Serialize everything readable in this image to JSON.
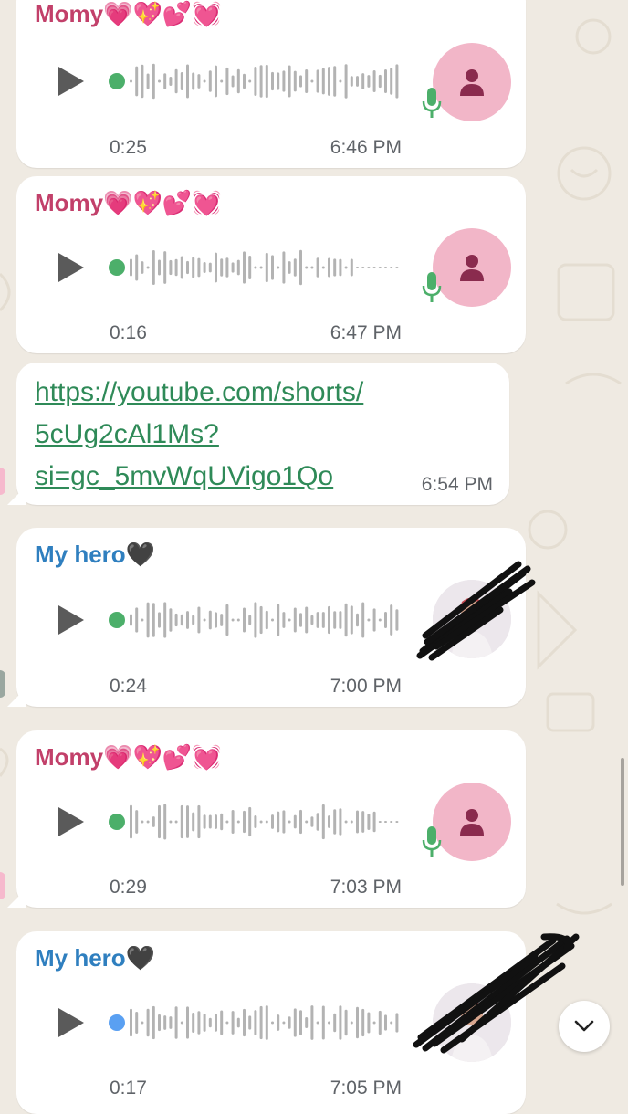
{
  "colors": {
    "background": "#efeae2",
    "bubble": "#ffffff",
    "momy_name": "#c2406a",
    "hero_name": "#2f7fbf",
    "link": "#2f8a58",
    "unplayed_dot": "#4caf6a",
    "played_dot": "#5aa0f2",
    "mic_green": "#4caf6a",
    "avatar_pink": "#f2b6c8",
    "avatar_icon": "#8a2b4e",
    "meta_text": "#5f6368"
  },
  "messages": [
    {
      "sender": "Momy",
      "emojis": "💗💖💕💓",
      "type": "voice",
      "duration": "0:25",
      "time": "6:46 PM",
      "avatar": "person-placeholder-icon"
    },
    {
      "sender": "Momy",
      "emojis": "💗💖💕💓",
      "type": "voice",
      "duration": "0:16",
      "time": "6:47 PM",
      "avatar": "person-placeholder-icon"
    },
    {
      "type": "link",
      "lines": [
        "https://youtube.com/shorts/",
        "5cUg2cAl1Ms?",
        "si=gc_5mvWqUVigo1Qo"
      ],
      "time": "6:54 PM"
    },
    {
      "sender": "My hero",
      "emojis": "🖤",
      "type": "voice",
      "duration": "0:24",
      "time": "7:00 PM",
      "avatar": "profile-photo"
    },
    {
      "sender": "Momy",
      "emojis": "💗💖💕💓",
      "type": "voice",
      "duration": "0:29",
      "time": "7:03 PM",
      "avatar": "person-placeholder-icon"
    },
    {
      "sender": "My hero",
      "emojis": "🖤",
      "type": "voice",
      "duration": "0:17",
      "time": "7:05 PM",
      "avatar": "profile-photo"
    }
  ],
  "icons": {
    "play": "play-icon",
    "mic": "microphone-icon",
    "scroll_down": "chevron-down-icon"
  }
}
